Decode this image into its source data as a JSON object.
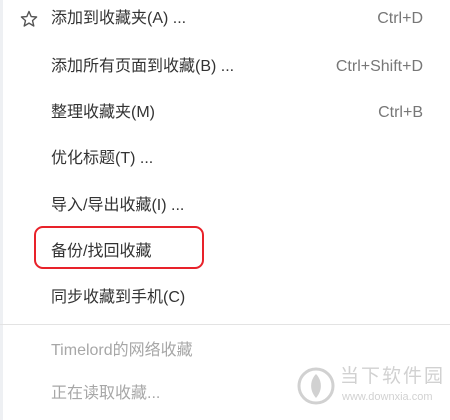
{
  "menu": {
    "items": [
      {
        "label": "添加到收藏夹(A) ...",
        "shortcut": "Ctrl+D",
        "icon": "star-outline-icon"
      },
      {
        "label": "添加所有页面到收藏(B) ...",
        "shortcut": "Ctrl+Shift+D"
      },
      {
        "label": "整理收藏夹(M)",
        "shortcut": "Ctrl+B"
      },
      {
        "label": "优化标题(T) ..."
      },
      {
        "label": "导入/导出收藏(I) ..."
      },
      {
        "label": "备份/找回收藏"
      },
      {
        "label": "同步收藏到手机(C)"
      }
    ],
    "online_items": [
      {
        "label": "Timelord的网络收藏"
      },
      {
        "label": "正在读取收藏..."
      }
    ]
  },
  "annotation": {
    "color": "#e8222a"
  },
  "watermark": {
    "title": "当下软件园",
    "url": "www.downxia.com"
  }
}
